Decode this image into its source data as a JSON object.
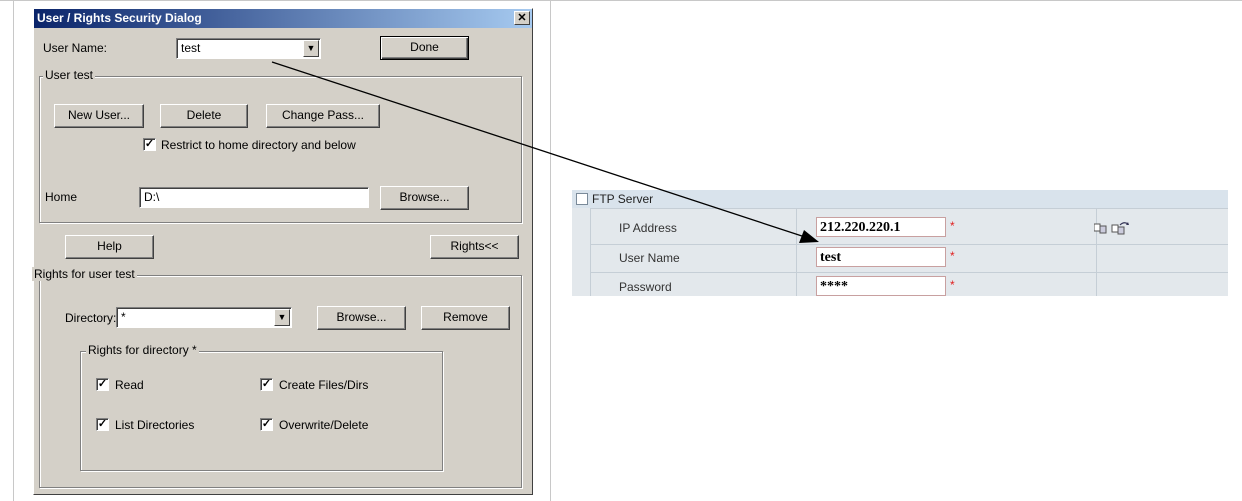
{
  "dialog": {
    "title": "User / Rights Security Dialog",
    "close_glyph": "✕",
    "user_name_label": "User Name:",
    "user_name_value": "test",
    "done_label": "Done",
    "user_group_label": "User test",
    "new_user_label": "New User...",
    "delete_label": "Delete",
    "change_pass_label": "Change Pass...",
    "restrict_label": "Restrict to home directory and below",
    "restrict_checked": true,
    "home_label": "Home",
    "home_value": "D:\\",
    "browse_label": "Browse...",
    "help_label": "Help",
    "rights_toggle_label": "Rights<<",
    "rights_group_label": "Rights for user test",
    "directory_label": "Directory:",
    "directory_value": "*",
    "dir_browse_label": "Browse...",
    "remove_label": "Remove",
    "dir_rights_group_label": "Rights for directory *",
    "read_label": "Read",
    "create_label": "Create Files/Dirs",
    "list_label": "List Directories",
    "overwrite_label": "Overwrite/Delete",
    "check_glyph": "✓",
    "dropdown_glyph": "▼"
  },
  "ftp": {
    "title": "FTP Server",
    "rows": [
      {
        "label": "IP Address",
        "value": "212.220.220.1"
      },
      {
        "label": "User Name",
        "value": "test"
      },
      {
        "label": "Password",
        "value": "****"
      }
    ],
    "required_mark": "*",
    "tool_icons": "copy-paste-icons"
  },
  "colors": {
    "dialog_bg": "#d4d0c8",
    "title_start": "#0a246a",
    "title_end": "#a6caf0",
    "ftp_bg": "#e3e8ec",
    "required": "#e02020"
  }
}
